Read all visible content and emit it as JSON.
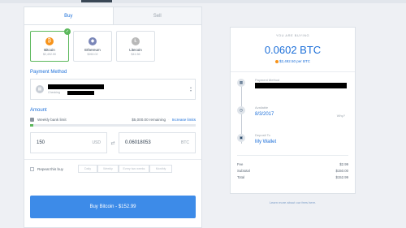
{
  "tabs": {
    "buy": "Buy",
    "sell": "Sell"
  },
  "coins": [
    {
      "name": "Bitcoin",
      "price": "$2,492.50",
      "color": "#f7931a",
      "glyph": "₿",
      "selected": true
    },
    {
      "name": "Ethereum",
      "price": "$260.02",
      "color": "#7a86b8",
      "glyph": "◆",
      "selected": false
    },
    {
      "name": "Litecoin",
      "price": "$41.56",
      "color": "#b8b8b8",
      "glyph": "Ł",
      "selected": false
    }
  ],
  "payment": {
    "title": "Payment Method",
    "sub": "Checking"
  },
  "amount": {
    "title": "Amount",
    "limit_label": "Weekly bank limit",
    "remaining": "$5,000.00 remaining",
    "increase": "Increase limits",
    "limit_used_fraction": 0.02,
    "usd_value": "150",
    "usd_cur": "USD",
    "btc_value": "0.06018053",
    "btc_cur": "BTC"
  },
  "repeat": {
    "label": "Repeat this buy",
    "options": [
      "Daily",
      "Weekly",
      "Every two weeks",
      "Monthly"
    ]
  },
  "buy_button": "Buy Bitcoin - $152.99",
  "summary": {
    "buying_label": "YOU ARE BUYING",
    "amount": "0.0602 BTC",
    "per": "$2,492.50 per BTC",
    "payment_label": "Payment Method",
    "available_label": "Available",
    "available_date": "8/3/2017",
    "why": "Why?",
    "deposit_label": "Deposit To",
    "deposit_value": "My Wallet",
    "rows": [
      {
        "label": "Fee",
        "value": "$2.99"
      },
      {
        "label": "Subtotal",
        "value": "$150.00"
      },
      {
        "label": "Total",
        "value": "$152.99"
      }
    ]
  },
  "learn_more": "Learn more about our fees here."
}
